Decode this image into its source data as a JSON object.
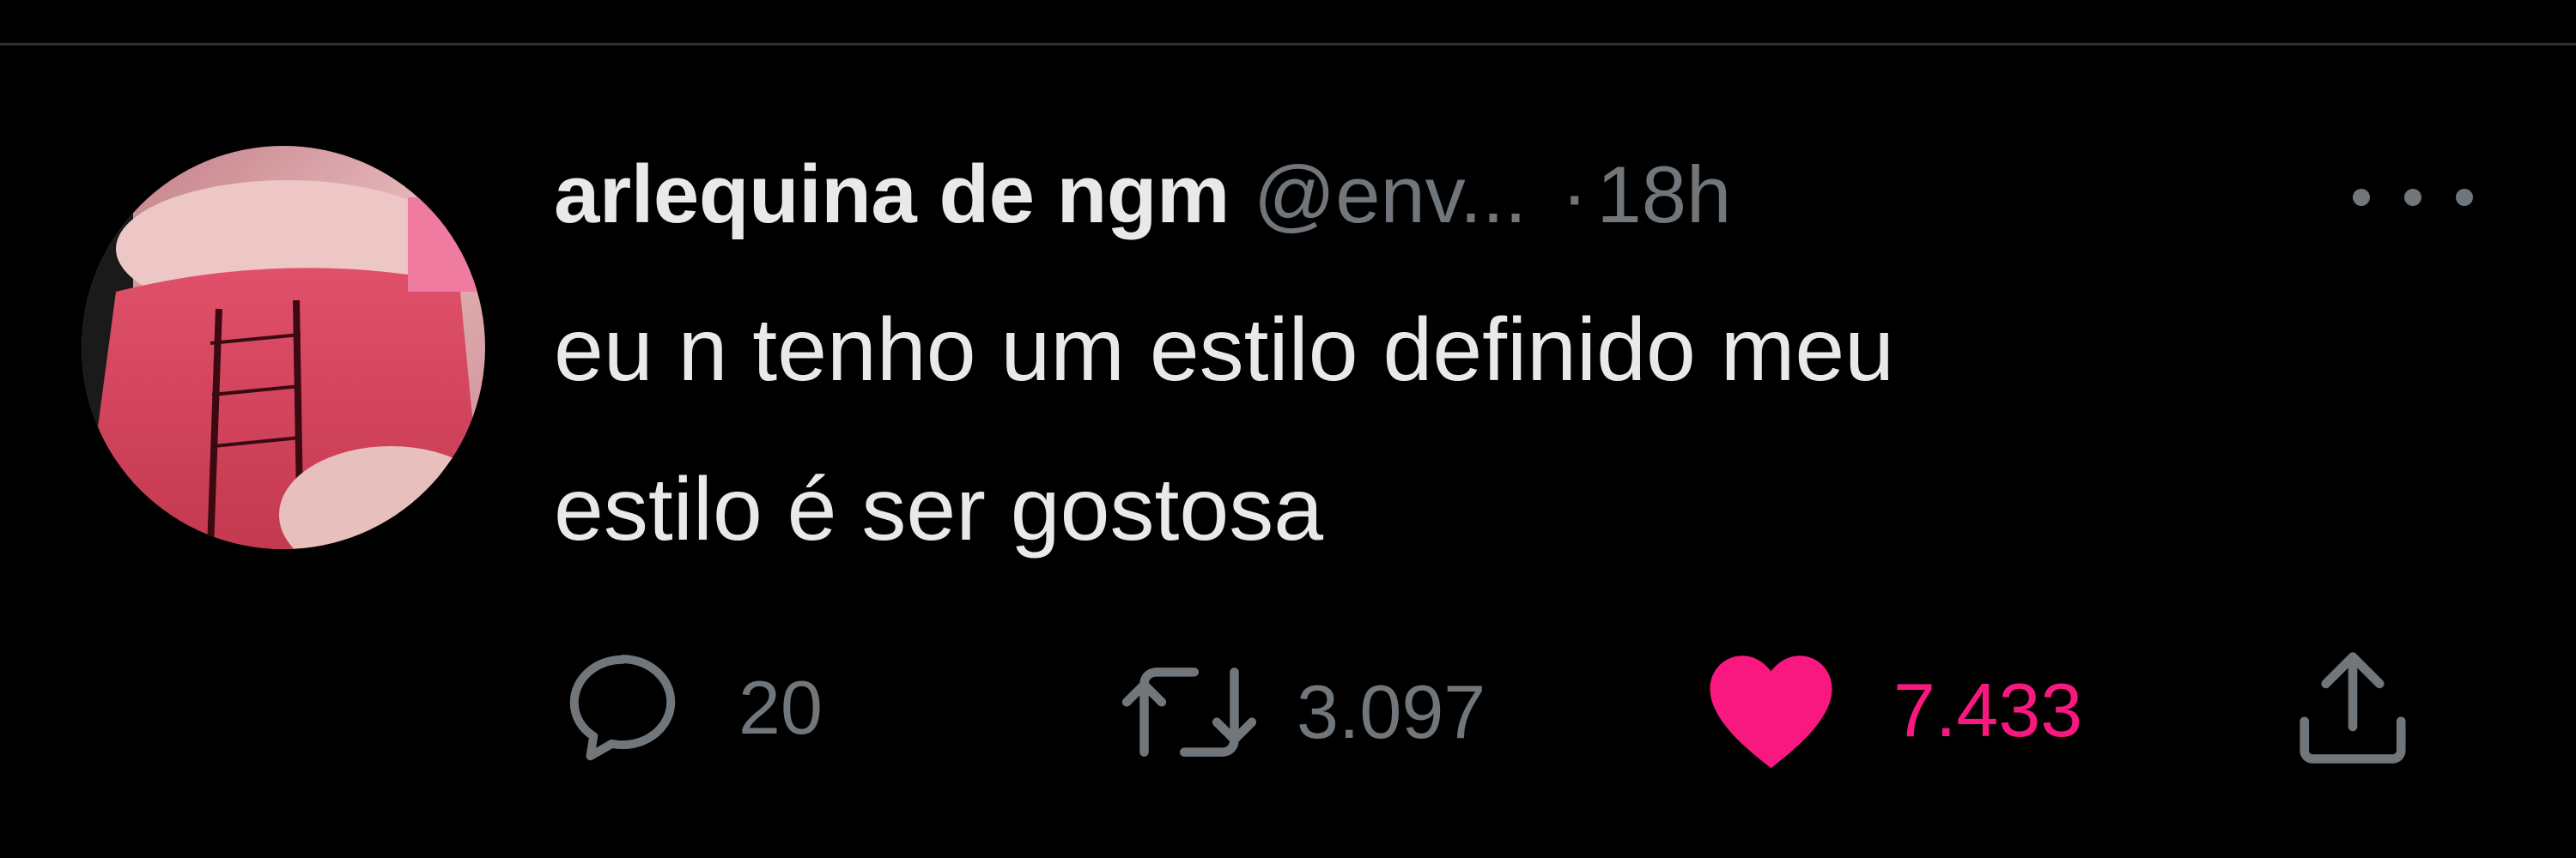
{
  "tweet": {
    "display_name": "arlequina de ngm",
    "handle": "@env...",
    "separator": "·",
    "time": "18h",
    "text_lines": [
      "eu n tenho um estilo definido meu",
      "estilo é ser gostosa"
    ]
  },
  "actions": {
    "reply": {
      "icon": "speech-bubble-icon",
      "count": "20"
    },
    "retweet": {
      "icon": "retweet-arrows-icon",
      "count": "3.097"
    },
    "like": {
      "icon": "heart-icon",
      "count": "7.433",
      "liked": true
    },
    "share": {
      "icon": "share-upload-icon"
    }
  },
  "colors": {
    "background": "#000000",
    "primary_text": "#e7e9ea",
    "secondary_text": "#71767b",
    "like_accent": "#f91880",
    "divider": "#2f3336"
  }
}
